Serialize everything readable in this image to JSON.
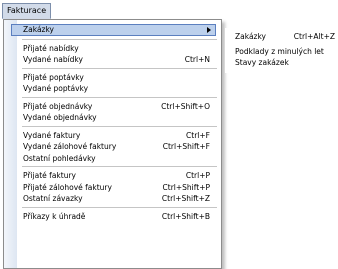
{
  "menubar": {
    "title": "Fakturace"
  },
  "menu": {
    "groups": [
      [
        {
          "label": "Zakázky",
          "shortcut": "",
          "submenu": true,
          "highlighted": true
        }
      ],
      [
        {
          "label": "Přijaté nabídky",
          "shortcut": ""
        },
        {
          "label": "Vydané nabídky",
          "shortcut": "Ctrl+N"
        }
      ],
      [
        {
          "label": "Přijaté poptávky",
          "shortcut": ""
        },
        {
          "label": "Vydané poptávky",
          "shortcut": ""
        }
      ],
      [
        {
          "label": "Přijaté objednávky",
          "shortcut": "Ctrl+Shift+O"
        },
        {
          "label": "Vydané objednávky",
          "shortcut": ""
        }
      ],
      [
        {
          "label": "Vydané faktury",
          "shortcut": "Ctrl+F"
        },
        {
          "label": "Vydané zálohové faktury",
          "shortcut": "Ctrl+Shift+F"
        },
        {
          "label": "Ostatní pohledávky",
          "shortcut": ""
        }
      ],
      [
        {
          "label": "Přijaté faktury",
          "shortcut": "Ctrl+P"
        },
        {
          "label": "Přijaté zálohové faktury",
          "shortcut": "Ctrl+Shift+P"
        },
        {
          "label": "Ostatní závazky",
          "shortcut": "Ctrl+Shift+Z"
        }
      ],
      [
        {
          "label": "Příkazy k úhradě",
          "shortcut": "Ctrl+Shift+B"
        }
      ]
    ]
  },
  "submenu": {
    "items": [
      {
        "label": "Zakázky",
        "shortcut": "Ctrl+Alt+Z"
      },
      {
        "label": "Podklady z minulých let",
        "shortcut": ""
      },
      {
        "label": "Stavy zakázek",
        "shortcut": ""
      }
    ]
  }
}
